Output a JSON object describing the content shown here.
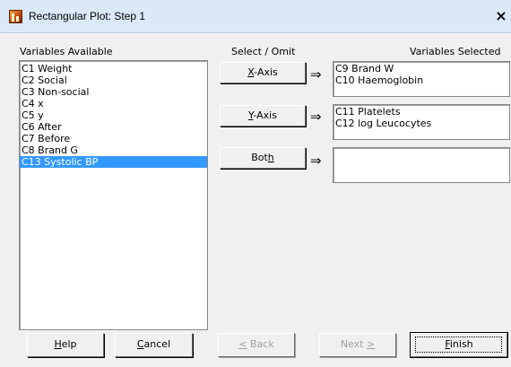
{
  "window": {
    "title": "Rectangular Plot: Step 1",
    "close_label": "×"
  },
  "labels": {
    "variables_available": "Variables Available",
    "select_omit": "Select / Omit",
    "variables_selected": "Variables Selected"
  },
  "available_variables": [
    "C1 Weight",
    "C2 Social",
    "C3 Non-social",
    "C4 x",
    "C5 y",
    "C6 After",
    "C7 Before",
    "C8 Brand G",
    "C13 Systolic BP"
  ],
  "selected_available": "C13 Systolic BP",
  "axes": {
    "x": {
      "button_pre": "",
      "button_key": "X",
      "button_post": "-Axis",
      "items": [
        "C9 Brand W",
        "C10 Haemoglobin"
      ]
    },
    "y": {
      "button_pre": "",
      "button_key": "Y",
      "button_post": "-Axis",
      "items": [
        "C11 Platelets",
        "C12 log Leucocytes"
      ]
    },
    "both": {
      "button_pre": "Bot",
      "button_key": "h",
      "button_post": "",
      "items": []
    }
  },
  "arrow_glyph": "⇒",
  "buttons": {
    "help": {
      "key": "H",
      "rest": "elp"
    },
    "cancel": {
      "key": "C",
      "rest": "ancel"
    },
    "back": {
      "pre": "",
      "key": "<",
      "rest": " Back"
    },
    "next": {
      "pre": "Next ",
      "key": ">",
      "rest": ""
    },
    "finish": {
      "key": "F",
      "rest": "inish"
    }
  }
}
